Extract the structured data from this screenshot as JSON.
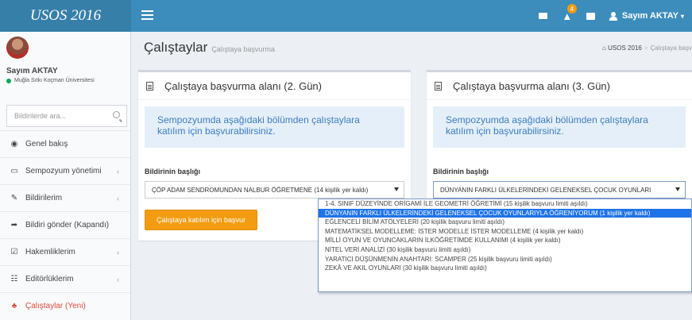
{
  "app": {
    "title": "USOS 2016"
  },
  "topbar": {
    "notification_count": "4",
    "user_name": "Sayım AKTAY"
  },
  "sidebar": {
    "user_name": "Sayım AKTAY",
    "university": "Muğla Sıtkı Koçman Üniversitesi",
    "search_placeholder": "Bildirilerde ara...",
    "items": [
      {
        "label": "Genel bakış",
        "icon": "dashboard-icon",
        "chevron": ""
      },
      {
        "label": "Sempozyum yönetimi",
        "icon": "desktop-icon",
        "chevron": "‹"
      },
      {
        "label": "Bildirilerim",
        "icon": "edit-icon",
        "chevron": "‹"
      },
      {
        "label": "Bildiri gönder (Kapandı)",
        "icon": "share-icon",
        "chevron": ""
      },
      {
        "label": "Hakemliklerim",
        "icon": "checkbox-icon",
        "chevron": "‹"
      },
      {
        "label": "Editörlüklerim",
        "icon": "group-icon",
        "chevron": "‹"
      },
      {
        "label": "Çalıştaylar (Yeni)",
        "icon": "sitemap-icon",
        "chevron": ""
      }
    ]
  },
  "header": {
    "title": "Çalıştaylar",
    "subtitle": "Çalıştaya başvurma",
    "breadcrumb_home": "USOS 2016",
    "breadcrumb_current": "Çalıştaya başv"
  },
  "boxes": [
    {
      "title": "Çalıştaya başvurma alanı (2. Gün)",
      "callout_line1": "Sempozyumda aşağıdaki bölümden çalıştaylara",
      "callout_line2": "katılım için başvurabilirsiniz.",
      "field_label": "Bildirinin başlığı",
      "selected": "ÇÖP ADAM SENDROMUNDAN NALBUR ÖĞRETMENE (14 kişilik yer kaldı)",
      "button": "Çalıştaya katılım için başvur"
    },
    {
      "title": "Çalıştaya başvurma alanı (3. Gün)",
      "callout_line1": "Sempozyumda aşağıdaki bölümden çalıştaylara",
      "callout_line2": "katılım için başvurabilirsiniz.",
      "field_label": "Bildirinin başlığı",
      "selected": "DÜNYANIN FARKLI ÜLKELERİNDEKİ GELENEKSEL ÇOCUK OYUNLARI"
    }
  ],
  "dropdown_options": [
    "1-4. SINIF DÜZEYİNDE ORİGAMİ İLE GEOMETRİ ÖĞRETİMİ (15 kişilik başvuru limiti aşıldı)",
    "DÜNYANIN FARKLI ÜLKELERİNDEKİ GELENEKSEL ÇOCUK OYUNLARIYLA ÖĞRENİYORUM (1 kişilik yer kaldı)",
    "EĞLENCELİ BİLİM ATÖLYELERİ (20 kişilik başvuru limiti aşıldı)",
    "MATEMATİKSEL MODELLEME: İSTER MODELLE İSTER MODELLEME (4 kişilik yer kaldı)",
    "MİLLİ OYUN VE OYUNCAKLARIN İLKÖĞRETİMDE KULLANIMI (4 kişilik yer kaldı)",
    "NİTEL VERİ ANALİZİ (30 kişilik başvuru limiti aşıldı)",
    "YARATICI DÜŞÜNMENİN ANAHTARI: SCAMPER (25 kişilik başvuru limiti aşıldı)",
    "ZEKÂ VE AKIL OYUNLARI (30 kişilik başvuru limiti aşıldı)"
  ],
  "dropdown_selected_index": 1,
  "colors": {
    "topbar": "#3c8dbc",
    "logo_bg": "#367fa9",
    "accent_orange": "#f39c12",
    "active_red": "#dd4b39",
    "callout_text": "#3a7cbf",
    "dropdown_highlight": "#1e73e8"
  }
}
